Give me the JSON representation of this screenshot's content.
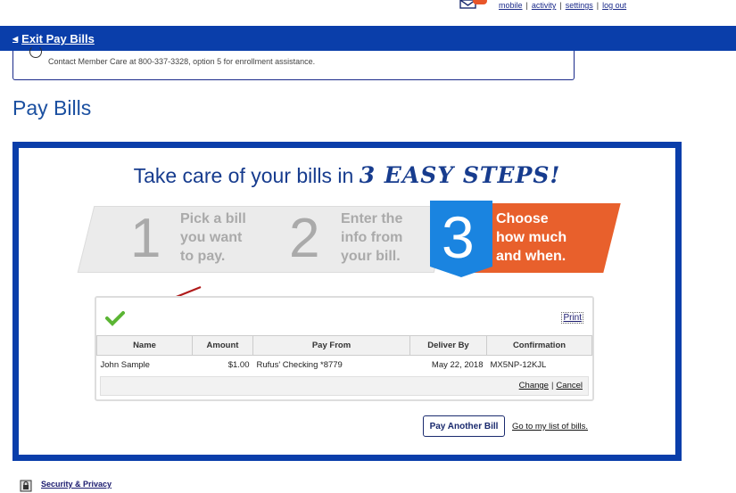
{
  "topnav": {
    "links": [
      "mobile",
      "activity",
      "settings",
      "log out"
    ]
  },
  "header": {
    "exit_label": "Exit Pay Bills"
  },
  "notice": {
    "text": "Contact Member Care at 800-337-3328, option 5 for enrollment assistance."
  },
  "page": {
    "title": "Pay Bills"
  },
  "banner": {
    "headline_lead": "Take care of your bills in",
    "headline_emph": "3 EASY STEPS!",
    "steps": [
      {
        "number": "1",
        "text": "Pick a bill\nyou want\nto pay."
      },
      {
        "number": "2",
        "text": "Enter the\ninfo from\nyour bill."
      },
      {
        "number": "3",
        "text": "Choose\nhow much\nand when."
      }
    ]
  },
  "confirmation": {
    "print_label": "Print",
    "columns": [
      "Name",
      "Amount",
      "Pay From",
      "Deliver By",
      "Confirmation"
    ],
    "row": {
      "name": "John Sample",
      "amount": "$1.00",
      "pay_from": "Rufus' Checking *8779",
      "deliver_by": "May 22, 2018",
      "confirmation": "MX5NP-12KJL"
    },
    "change_label": "Change",
    "cancel_label": "Cancel"
  },
  "actions": {
    "pay_another_label": "Pay Another Bill",
    "goto_list_label": "Go to my list of bills."
  },
  "footer": {
    "security_label": "Security & Privacy"
  },
  "colors": {
    "brand_blue": "#0a3eaa",
    "step_blue": "#1a84e0",
    "step_orange": "#e8602c",
    "check_green": "#5bb534",
    "arrow_red": "#b01a1a"
  }
}
